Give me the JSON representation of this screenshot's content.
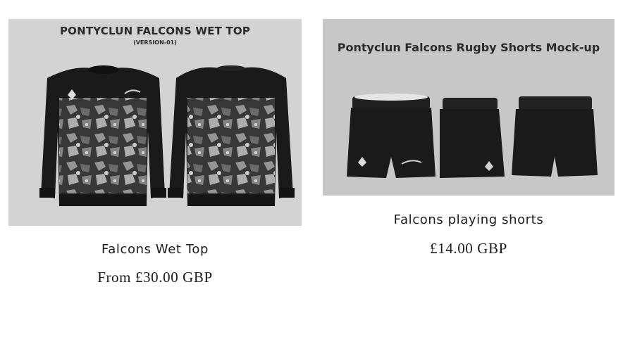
{
  "products": [
    {
      "image": {
        "title": "PONTYCLUN FALCONS WET TOP",
        "subtitle": "(VERSION-01)"
      },
      "name": "Falcons Wet Top",
      "price": "From £30.00 GBP"
    },
    {
      "image": {
        "title": "Pontyclun Falcons Rugby Shorts Mock-up"
      },
      "name": "Falcons playing shorts",
      "price": "£14.00 GBP"
    }
  ],
  "colors": {
    "garment": "#1a1a1a",
    "camo_light": "#9a9a9a",
    "camo_mid": "#6e6e6e",
    "image_bg_1": "#d3d3d4",
    "image_bg_2": "#c7c7c8"
  }
}
